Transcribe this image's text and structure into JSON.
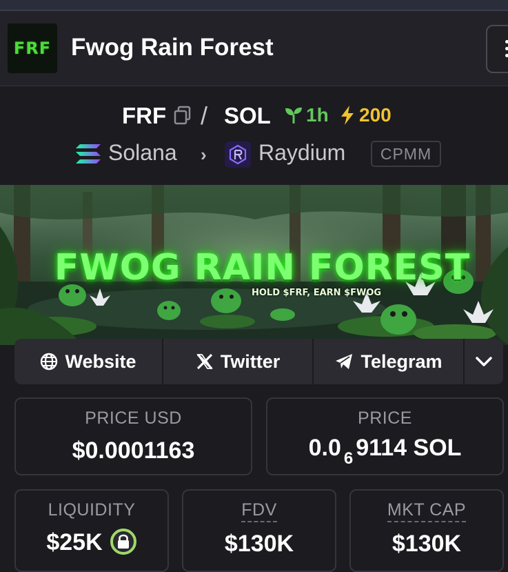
{
  "header": {
    "logo_text": "FRF",
    "title": "Fwog Rain Forest"
  },
  "pair": {
    "base": "FRF",
    "separator": "/",
    "quote": "SOL",
    "age": "1h",
    "boosts": "200",
    "chain": "Solana",
    "dex": "Raydium",
    "dex_type": "CPMM"
  },
  "banner": {
    "title": "FWOG RAIN FOREST",
    "subtitle": "HOLD $FRF, EARN $FWOG"
  },
  "links": {
    "website": "Website",
    "twitter": "Twitter",
    "telegram": "Telegram"
  },
  "stats": {
    "price_usd_label": "PRICE USD",
    "price_usd": "$0.0001163",
    "price_label": "PRICE",
    "price_prefix": "0.0",
    "price_zeros": "6",
    "price_suffix": "9114 SOL",
    "liquidity_label": "LIQUIDITY",
    "liquidity": "$25K",
    "fdv_label": "FDV",
    "fdv": "$130K",
    "mktcap_label": "MKT CAP",
    "mktcap": "$130K"
  },
  "colors": {
    "background": "#1b1b20",
    "age_green": "#63c75b",
    "boost_yellow": "#f0c230",
    "lock_green": "#a0d86a"
  }
}
